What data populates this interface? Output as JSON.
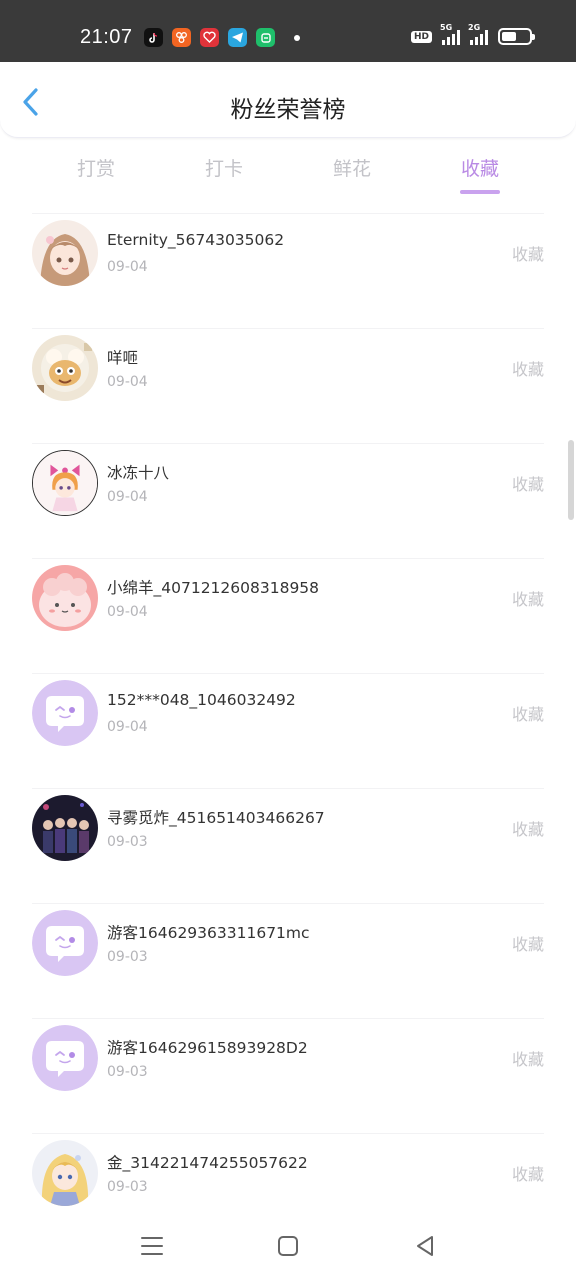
{
  "status_bar": {
    "time": "21:07",
    "app_icons": [
      "tiktok-icon",
      "app-icon-orange",
      "app-icon-red",
      "telegram-icon",
      "app-icon-green"
    ],
    "hd_badge": "HD",
    "signal1_label": "5G",
    "signal2_label": "2G",
    "battery_level": 0.45
  },
  "header": {
    "title": "粉丝荣誉榜",
    "back_icon": "chevron-left-icon",
    "accent": "#4aa3e8"
  },
  "tabs": [
    {
      "label": "打赏",
      "active": false
    },
    {
      "label": "打卡",
      "active": false
    },
    {
      "label": "鲜花",
      "active": false
    },
    {
      "label": "收藏",
      "active": true
    }
  ],
  "accent_color": "#b98ae4",
  "list": [
    {
      "name": "Eternity_56743035062",
      "date": "09-04",
      "action": "收藏",
      "avatar": "anime-girl-avatar"
    },
    {
      "name": "咩咂",
      "date": "09-04",
      "action": "收藏",
      "avatar": "cartoon-avatar"
    },
    {
      "name": "冰冻十八",
      "date": "09-04",
      "action": "收藏",
      "avatar": "anime-girl-bow-avatar"
    },
    {
      "name": "小绵羊_4071212608318958",
      "date": "09-04",
      "action": "收藏",
      "avatar": "pink-sheep-avatar"
    },
    {
      "name": "152***048_1046032492",
      "date": "09-04",
      "action": "收藏",
      "avatar": "default-chat-avatar"
    },
    {
      "name": "寻雾觅炸_451651403466267",
      "date": "09-03",
      "action": "收藏",
      "avatar": "group-photo-avatar"
    },
    {
      "name": "游客164629363311671mc",
      "date": "09-03",
      "action": "收藏",
      "avatar": "default-chat-avatar"
    },
    {
      "name": "游客164629615893928D2",
      "date": "09-03",
      "action": "收藏",
      "avatar": "default-chat-avatar"
    },
    {
      "name": "金_314221474255057622",
      "date": "09-03",
      "action": "收藏",
      "avatar": "anime-blonde-avatar"
    }
  ],
  "nav": {
    "menu_icon": "menu-icon",
    "home_icon": "home-square-icon",
    "back_icon": "back-triangle-icon"
  }
}
